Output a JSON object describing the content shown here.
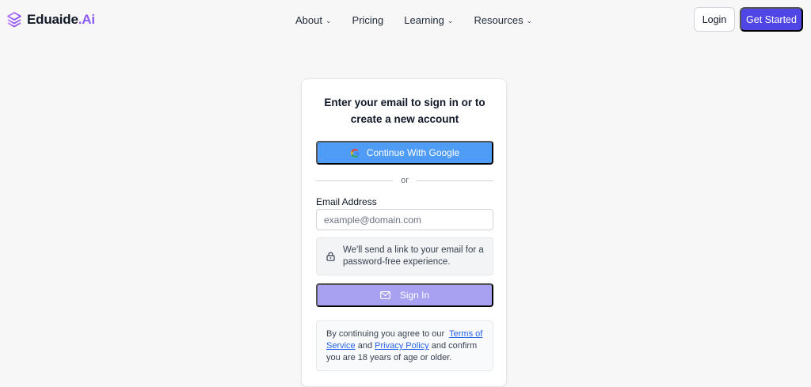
{
  "brand": {
    "name_main": "Eduaide",
    "name_accent": ".Ai",
    "logo_icon": "layers-icon",
    "accent_color": "#8b5cf6"
  },
  "nav": {
    "items": [
      {
        "label": "About",
        "has_dropdown": true
      },
      {
        "label": "Pricing",
        "has_dropdown": false
      },
      {
        "label": "Learning",
        "has_dropdown": true
      },
      {
        "label": "Resources",
        "has_dropdown": true
      }
    ],
    "dropdown_icon": "chevron-down-icon"
  },
  "header_actions": {
    "login_label": "Login",
    "get_started_label": "Get Started",
    "primary_color": "#4f46e5"
  },
  "signin_card": {
    "title": "Enter your email to sign in or to create a new account",
    "google_button_label": "Continue With Google",
    "google_button_color": "#4f9cf6",
    "divider_text": "or",
    "email_label": "Email Address",
    "email_placeholder": "example@domain.com",
    "email_value": "",
    "info_text": "We'll send a link to your email for a password-free experience.",
    "signin_label": "Sign In",
    "signin_color_disabled": "#a8a0f1",
    "terms": {
      "prefix": "By continuing you agree to our",
      "terms_link": "Terms of Service",
      "and": "and",
      "privacy_link": "Privacy Policy",
      "suffix": "and confirm you are 18 years of age or older."
    }
  }
}
